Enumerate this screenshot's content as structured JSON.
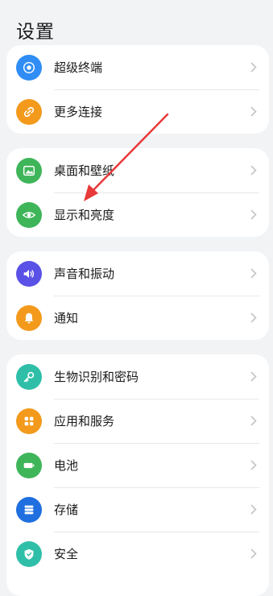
{
  "page_title": "设置",
  "groups": [
    {
      "items": [
        {
          "label": "超级终端",
          "icon": "super-device-icon",
          "color": "#2f8df5"
        },
        {
          "label": "更多连接",
          "icon": "link-icon",
          "color": "#f39a1c"
        }
      ]
    },
    {
      "items": [
        {
          "label": "桌面和壁纸",
          "icon": "wallpaper-icon",
          "color": "#3fb55a"
        },
        {
          "label": "显示和亮度",
          "icon": "eye-icon",
          "color": "#3fb55a"
        }
      ]
    },
    {
      "items": [
        {
          "label": "声音和振动",
          "icon": "sound-icon",
          "color": "#5a52e6"
        },
        {
          "label": "通知",
          "icon": "bell-icon",
          "color": "#f39a1c"
        }
      ]
    },
    {
      "items": [
        {
          "label": "生物识别和密码",
          "icon": "key-icon",
          "color": "#2fbfa9"
        },
        {
          "label": "应用和服务",
          "icon": "apps-icon",
          "color": "#f39a1c"
        },
        {
          "label": "电池",
          "icon": "battery-icon",
          "color": "#3fb55a"
        },
        {
          "label": "存储",
          "icon": "storage-icon",
          "color": "#1f6fe0"
        },
        {
          "label": "安全",
          "icon": "shield-icon",
          "color": "#2fbfa9"
        }
      ]
    }
  ],
  "annotation": {
    "color": "#e83a3a"
  }
}
